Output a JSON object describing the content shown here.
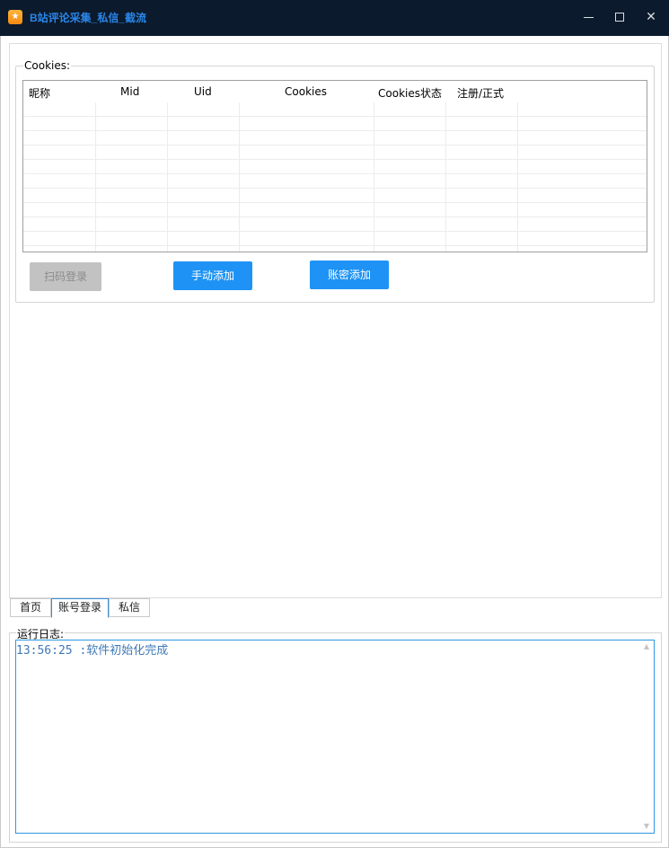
{
  "window": {
    "title": "B站评论采集_私信_截流",
    "icon": "app-star-icon",
    "controls": {
      "minimize": "minimize-icon",
      "maximize": "maximize-icon",
      "close": "close-icon"
    }
  },
  "cookies_group": {
    "legend": "Cookies:",
    "columns": [
      "昵称",
      "Mid",
      "Uid",
      "Cookies",
      "Cookies状态",
      "注册/正式"
    ],
    "rows": []
  },
  "buttons": {
    "scan_login": "扫码登录",
    "manual_add": "手动添加",
    "password_add": "账密添加"
  },
  "tabs": [
    {
      "label": "首页",
      "active": false
    },
    {
      "label": "账号登录",
      "active": true
    },
    {
      "label": "私信",
      "active": false
    }
  ],
  "log": {
    "legend": "运行日志:",
    "lines": [
      "13:56:25 :软件初始化完成"
    ]
  },
  "colors": {
    "titlebar": "#0b1a2c",
    "title_text": "#2a86e8",
    "primary_button": "#1e93f5",
    "disabled_button": "#c2c2c2",
    "log_text": "#3f79b6",
    "log_border": "#2f97e0"
  }
}
